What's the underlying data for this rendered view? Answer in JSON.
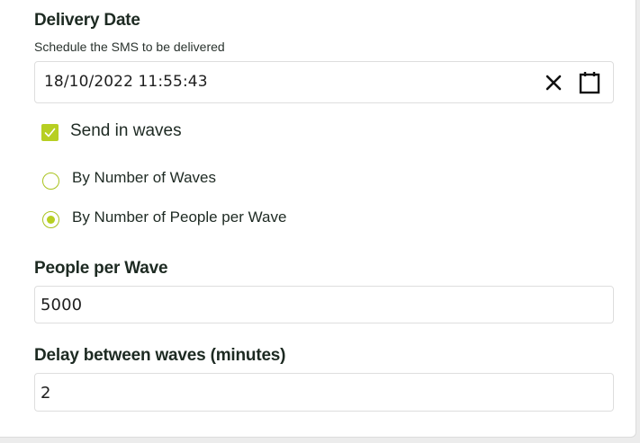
{
  "delivery": {
    "title": "Delivery Date",
    "subtitle": "Schedule the SMS to be delivered",
    "datetime_value": "18/10/2022 11:55:43",
    "clear_icon": "close-icon",
    "calendar_icon": "calendar-icon"
  },
  "waves": {
    "checkbox_label": "Send in waves",
    "checkbox_checked": true,
    "options": [
      {
        "label": "By Number of Waves",
        "selected": false
      },
      {
        "label": "By Number of People per Wave",
        "selected": true
      }
    ]
  },
  "people_per_wave": {
    "title": "People per Wave",
    "value": "5000"
  },
  "delay": {
    "title": "Delay between waves (minutes)",
    "value": "2"
  },
  "colors": {
    "accent": "#b7cf22",
    "text": "#1f2b24",
    "border": "#dedede"
  }
}
